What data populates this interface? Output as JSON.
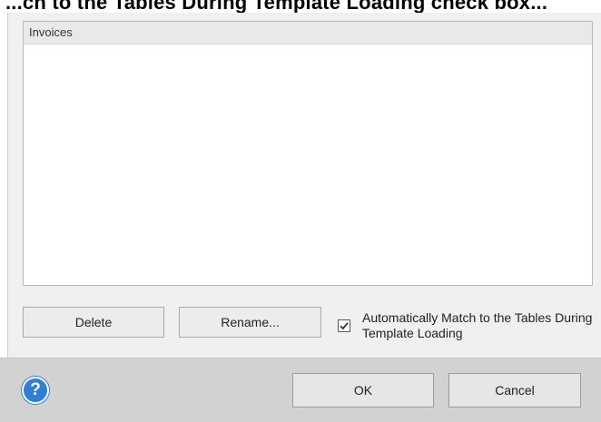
{
  "background_heading": "...ch to the Tables During Template Loading check box...",
  "list": {
    "header": "Invoices",
    "items": []
  },
  "buttons": {
    "delete": "Delete",
    "rename": "Rename...",
    "ok": "OK",
    "cancel": "Cancel"
  },
  "auto_match": {
    "label": "Automatically Match to the Tables During Template Loading",
    "checked": true
  },
  "help": {
    "glyph": "?",
    "icon": "help-icon"
  },
  "colors": {
    "accent": "#2f7fd6",
    "footer": "#d2d2d2",
    "panel": "#f0f0f0"
  }
}
